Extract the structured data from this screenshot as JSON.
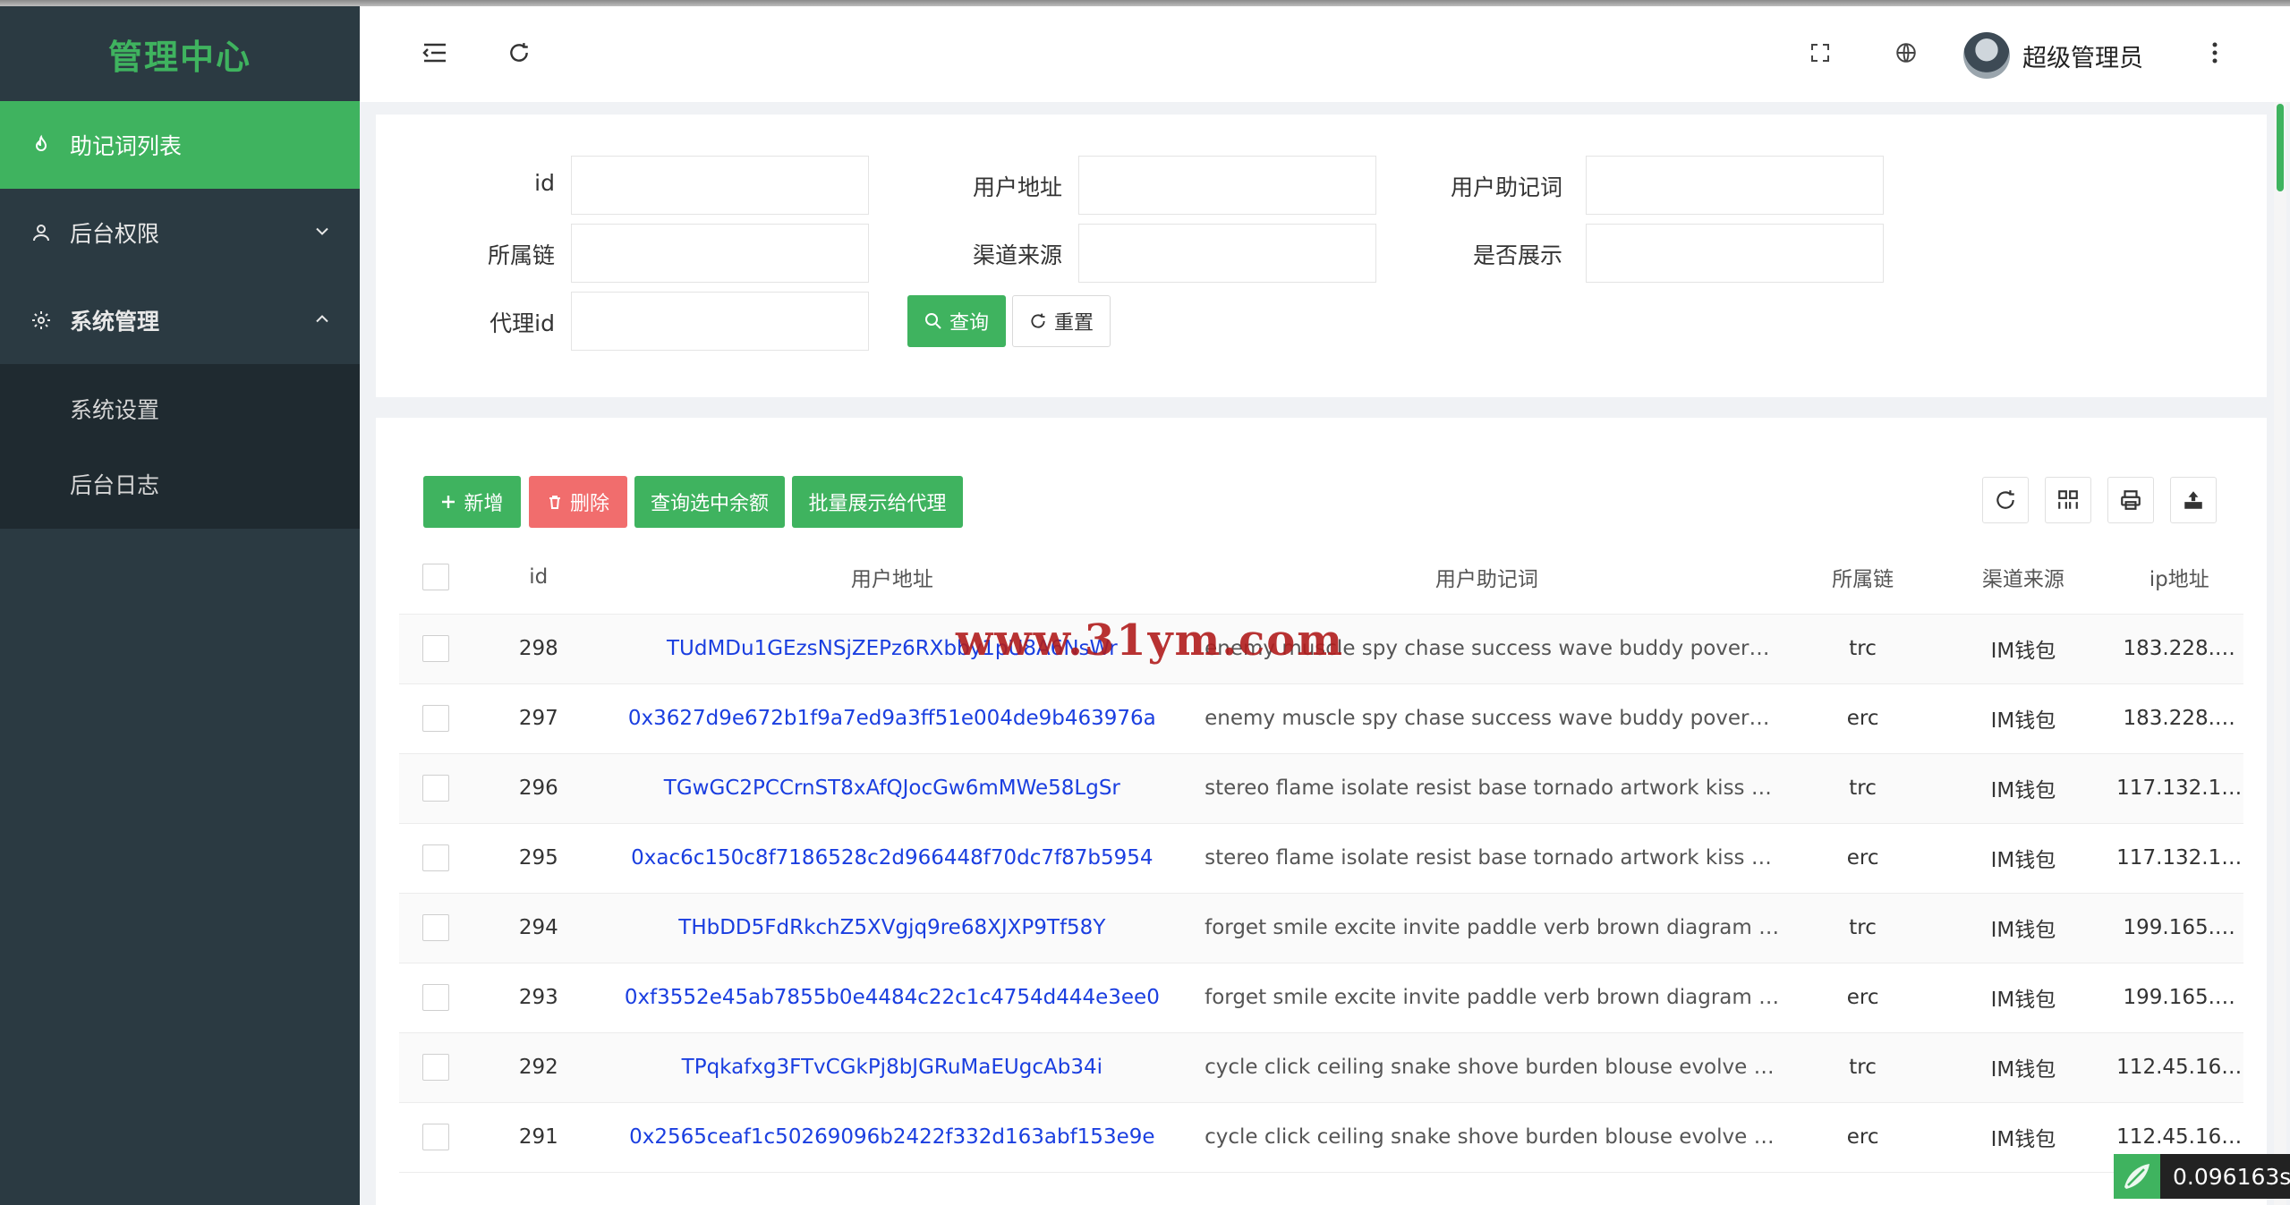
{
  "app": {
    "title": "管理中心"
  },
  "sidebar": {
    "items": [
      {
        "label": "助记词列表",
        "icon": "flame-icon",
        "active": true
      },
      {
        "label": "后台权限",
        "icon": "user-icon",
        "expanded": false
      },
      {
        "label": "系统管理",
        "icon": "gear-icon",
        "expanded": true
      }
    ],
    "subitems": [
      {
        "label": "系统设置"
      },
      {
        "label": "后台日志"
      }
    ]
  },
  "header": {
    "icons": [
      "menu-fold-icon",
      "refresh-icon",
      "fullscreen-icon",
      "globe-icon",
      "more-vertical-icon"
    ],
    "user_name": "超级管理员"
  },
  "search": {
    "fields": [
      {
        "label": "id",
        "value": ""
      },
      {
        "label": "用户地址",
        "value": ""
      },
      {
        "label": "用户助记词",
        "value": ""
      },
      {
        "label": "所属链",
        "value": ""
      },
      {
        "label": "渠道来源",
        "value": ""
      },
      {
        "label": "是否展示",
        "value": ""
      },
      {
        "label": "代理id",
        "value": ""
      }
    ],
    "query_label": "查询",
    "reset_label": "重置"
  },
  "toolbar": {
    "add_label": "新增",
    "delete_label": "删除",
    "query_balance_label": "查询选中余额",
    "batch_show_label": "批量展示给代理"
  },
  "table": {
    "columns": [
      "id",
      "用户地址",
      "用户助记词",
      "所属链",
      "渠道来源",
      "ip地址"
    ],
    "rows": [
      {
        "id": "298",
        "address": "TUdMDu1GEzsNSjZEPz6RXbby1pU8A6NsWr",
        "mnemonic": "enemy muscle spy chase success wave buddy pover…",
        "chain": "trc",
        "source": "IM钱包",
        "ip": "183.228.…"
      },
      {
        "id": "297",
        "address": "0x3627d9e672b1f9a7ed9a3ff51e004de9b463976a",
        "mnemonic": "enemy muscle spy chase success wave buddy pover…",
        "chain": "erc",
        "source": "IM钱包",
        "ip": "183.228.…"
      },
      {
        "id": "296",
        "address": "TGwGC2PCCrnST8xAfQJocGw6mMWe58LgSr",
        "mnemonic": "stereo flame isolate resist base tornado artwork kiss …",
        "chain": "trc",
        "source": "IM钱包",
        "ip": "117.132.1…"
      },
      {
        "id": "295",
        "address": "0xac6c150c8f7186528c2d966448f70dc7f87b5954",
        "mnemonic": "stereo flame isolate resist base tornado artwork kiss …",
        "chain": "erc",
        "source": "IM钱包",
        "ip": "117.132.1…"
      },
      {
        "id": "294",
        "address": "THbDD5FdRkchZ5XVgjq9re68XJXP9Tf58Y",
        "mnemonic": "forget smile excite invite paddle verb brown diagram …",
        "chain": "trc",
        "source": "IM钱包",
        "ip": "199.165.…"
      },
      {
        "id": "293",
        "address": "0xf3552e45ab7855b0e4484c22c1c4754d444e3ee0",
        "mnemonic": "forget smile excite invite paddle verb brown diagram …",
        "chain": "erc",
        "source": "IM钱包",
        "ip": "199.165.…"
      },
      {
        "id": "292",
        "address": "TPqkafxg3FTvCGkPj8bJGRuMaEUgcAb34i",
        "mnemonic": "cycle click ceiling snake shove burden blouse evolve …",
        "chain": "trc",
        "source": "IM钱包",
        "ip": "112.45.16…"
      },
      {
        "id": "291",
        "address": "0x2565ceaf1c50269096b2422f332d163abf153e9e",
        "mnemonic": "cycle click ceiling snake shove burden blouse evolve …",
        "chain": "erc",
        "source": "IM钱包",
        "ip": "112.45.16…"
      }
    ]
  },
  "watermark": "www.31ym.com",
  "timing": "0.096163s",
  "colors": {
    "accent": "#3fb35f",
    "danger": "#f16d6d",
    "sidebar": "#2b3a42",
    "link": "#1a3ee0"
  }
}
